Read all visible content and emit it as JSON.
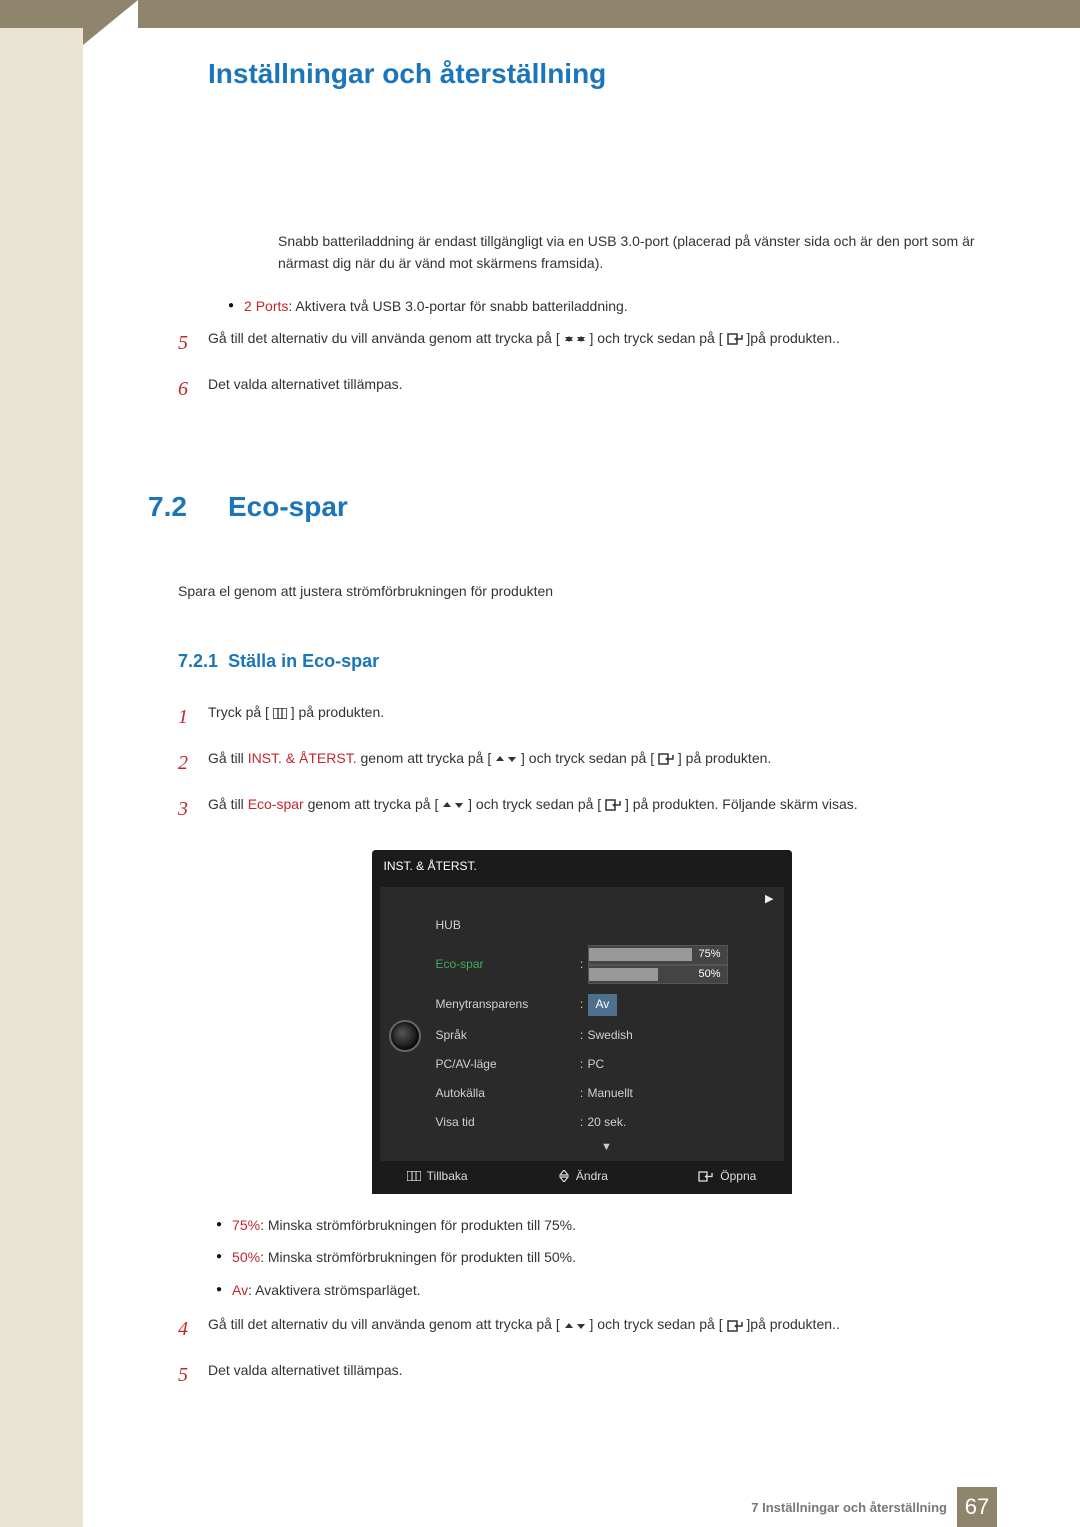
{
  "header": {
    "chapter_num": "7",
    "page_title": "Inställningar och återställning"
  },
  "pre_section": {
    "note": "Snabb batteriladdning är endast tillgängligt via en USB 3.0-port (placerad på vänster sida och är den port som är närmast dig när du är vänd mot skärmens framsida).",
    "bullet_label": "2 Ports",
    "bullet_text": ": Aktivera två USB 3.0-portar för snabb batteriladdning.",
    "step5_num": "5",
    "step5_a": "Gå till det alternativ du vill använda genom att trycka på [",
    "step5_b": "] och tryck sedan på [",
    "step5_c": "]på produkten..",
    "step6_num": "6",
    "step6_text": "Det valda alternativet tillämpas."
  },
  "section": {
    "num": "7.2",
    "title": "Eco-spar",
    "intro": "Spara el genom att justera strömförbrukningen för produkten",
    "sub_num": "7.2.1",
    "sub_title": "Ställa in Eco-spar"
  },
  "steps": {
    "s1_num": "1",
    "s1_a": "Tryck på [ ",
    "s1_b": " ] på produkten.",
    "s2_num": "2",
    "s2_a": "Gå till ",
    "s2_red": "INST. & ÅTERST.",
    "s2_b": " genom att trycka på [",
    "s2_c": "] och tryck sedan på [",
    "s2_d": "] på produkten.",
    "s3_num": "3",
    "s3_a": "Gå till ",
    "s3_red": "Eco-spar",
    "s3_b": " genom att trycka på [",
    "s3_c": "] och tryck sedan på [",
    "s3_d": "] på produkten. Följande skärm visas.",
    "s4_num": "4",
    "s4_a": "Gå till det alternativ du vill använda genom att trycka på [",
    "s4_b": "] och tryck sedan på [",
    "s4_c": "]på produkten..",
    "s5_num": "5",
    "s5_text": "Det valda alternativet tillämpas."
  },
  "osd": {
    "title": "INST. & ÅTERST.",
    "items": {
      "hub": "HUB",
      "eco": "Eco-spar",
      "menyt": "Menytransparens",
      "sprak": "Språk",
      "pcav": "PC/AV-läge",
      "auto": "Autokälla",
      "visa": "Visa tid"
    },
    "values": {
      "p75": "75%",
      "p50": "50%",
      "av": "Av",
      "sprak": "Swedish",
      "pcav": "PC",
      "auto": "Manuellt",
      "visa": "20 sek."
    },
    "foot": {
      "back": "Tillbaka",
      "change": "Ändra",
      "open": "Öppna"
    }
  },
  "bullets": {
    "b1_red": "75%",
    "b1_text": ": Minska strömförbrukningen för produkten till 75%.",
    "b2_red": "50%",
    "b2_text": ": Minska strömförbrukningen för produkten till 50%.",
    "b3_red": "Av",
    "b3_text": ": Avaktivera strömsparläget."
  },
  "footer": {
    "label": "7 Inställningar och återställning",
    "page": "67"
  }
}
